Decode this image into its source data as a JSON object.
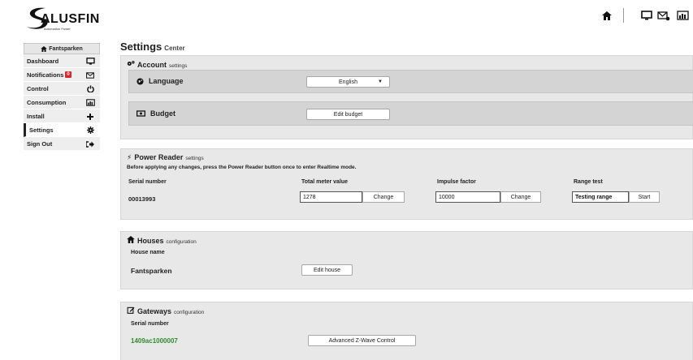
{
  "header": {
    "brand": "ALUSFIN",
    "tagline": "Automation Power",
    "icons": [
      "home-icon",
      "monitor-icon",
      "mail-settings-icon",
      "chart-icon"
    ]
  },
  "sidebar": {
    "location": "Fantsparken",
    "items": [
      {
        "label": "Dashboard",
        "icon": "monitor-icon"
      },
      {
        "label": "Notifications",
        "icon": "envelope-icon",
        "badge": "0"
      },
      {
        "label": "Control",
        "icon": "power-icon"
      },
      {
        "label": "Consumption",
        "icon": "chart-icon"
      },
      {
        "label": "Install",
        "icon": "plus-icon"
      },
      {
        "label": "Settings",
        "icon": "gear-icon",
        "active": true
      },
      {
        "label": "Sign Out",
        "icon": "sign-out-icon"
      }
    ]
  },
  "page": {
    "title": "Settings",
    "subtitle": "Center"
  },
  "account": {
    "title": "Account",
    "subtitle": "settings",
    "language_label": "Language",
    "language_value": "English",
    "budget_label": "Budget",
    "budget_button": "Edit budget"
  },
  "power_reader": {
    "title": "Power Reader",
    "subtitle": "settings",
    "note": "Before applying any changes, press the Power Reader button once to enter Realtime mode.",
    "serial_label": "Serial number",
    "serial_value": "00013993",
    "meter_label": "Total meter value",
    "meter_value": "1278",
    "impulse_label": "Impulse factor",
    "impulse_value": "10000",
    "change_label": "Change",
    "range_label": "Range test",
    "range_status": "Testing range",
    "start_label": "Start"
  },
  "houses": {
    "title": "Houses",
    "subtitle": "configuration",
    "name_label": "House name",
    "name_value": "Fantsparken",
    "edit_button": "Edit house"
  },
  "gateways": {
    "title": "Gateways",
    "subtitle": "configuration",
    "serial_label": "Serial number",
    "serial_value": "1409ac1000007",
    "zwave_button": "Advanced Z-Wave Control"
  },
  "colors": {
    "accent_green": "#2e8b2e",
    "badge_red": "#d9262b"
  }
}
